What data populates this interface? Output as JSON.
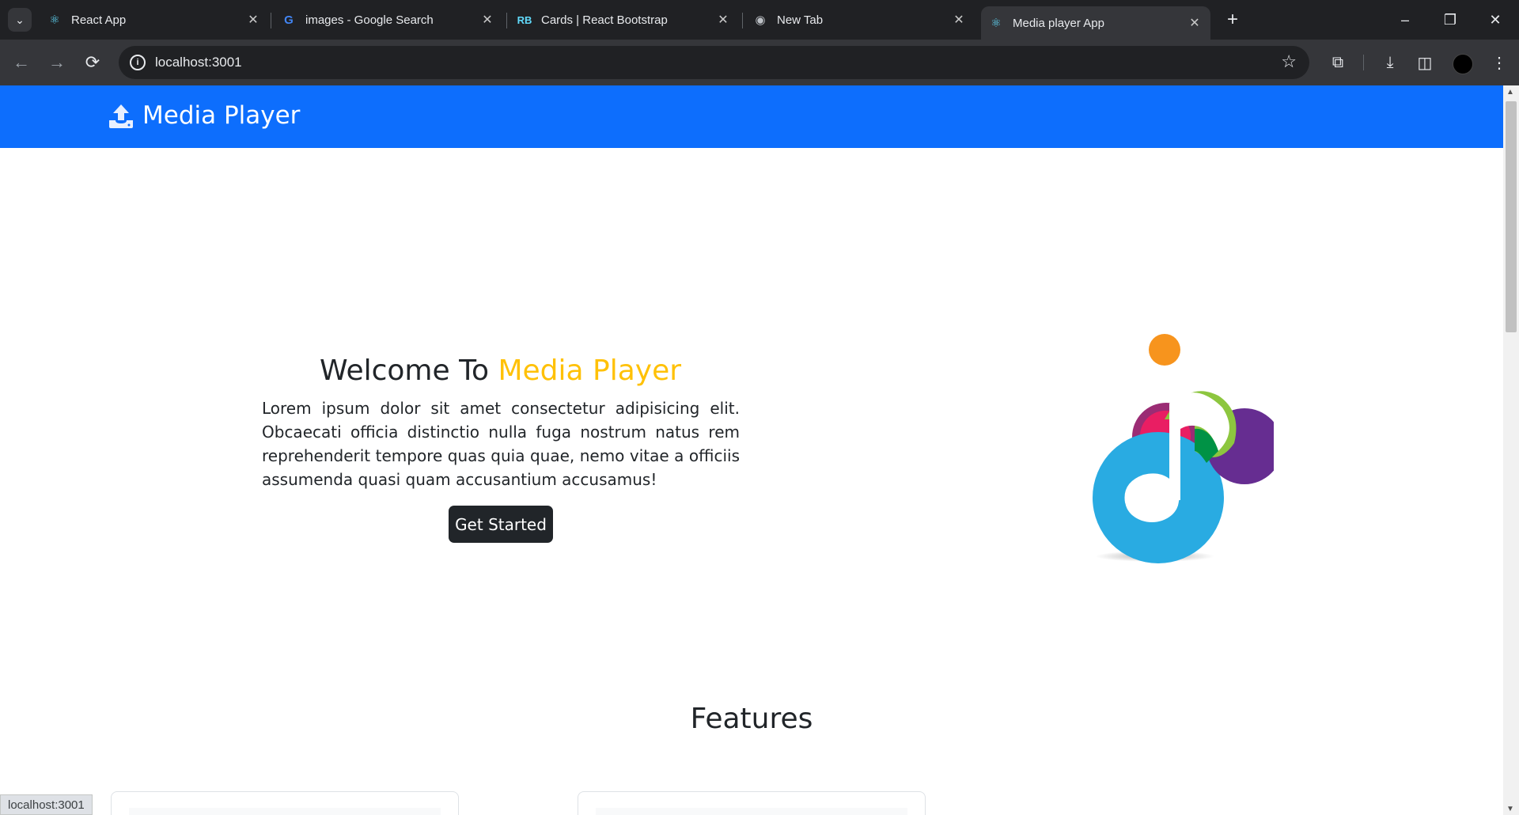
{
  "browser": {
    "tabs": [
      {
        "title": "React App",
        "icon": "react-icon"
      },
      {
        "title": "images - Google Search",
        "icon": "google-icon"
      },
      {
        "title": "Cards | React Bootstrap",
        "icon": "react-bootstrap-icon"
      },
      {
        "title": "New Tab",
        "icon": "chrome-icon"
      },
      {
        "title": "Media player App",
        "icon": "react-icon",
        "active": true
      }
    ],
    "url": "localhost:3001",
    "status_text": "localhost:3001"
  },
  "navbar": {
    "brand": "Media Player",
    "icon": "upload-icon",
    "color": "#0d6efd"
  },
  "hero": {
    "title_prefix": "Welcome To",
    "title_accent": "Media Player",
    "accent_color": "#ffc107",
    "text": "Lorem ipsum dolor sit amet consectetur adipisicing elit. Obcaecati officia distinctio nulla fuga nostrum natus rem reprehenderit tempore quas quia quae, nemo vitae a officiis assumenda quasi quam accusantium accusamus!",
    "button": "Get Started"
  },
  "features": {
    "title": "Features"
  }
}
